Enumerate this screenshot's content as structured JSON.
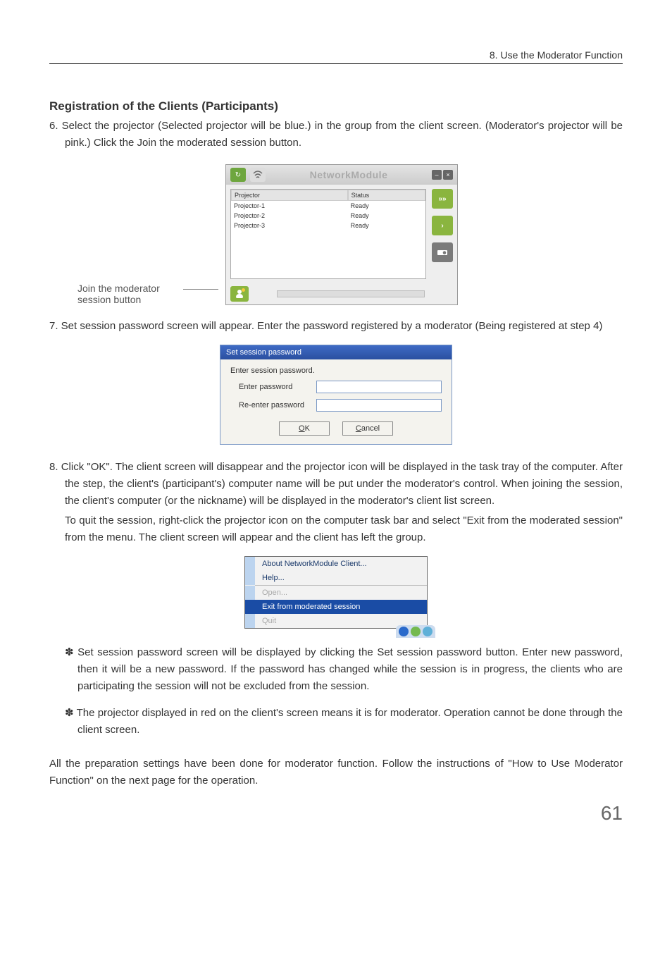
{
  "header": {
    "chapter": "8. Use the Moderator Function"
  },
  "title": "Registration of the Clients (Participants)",
  "step6": "6. Select the projector (Selected projector will be blue.) in the group from the client screen. (Moderator's projector will be pink.) Click the Join the moderated session button.",
  "callout": "Join the moderator session button",
  "nm": {
    "title": "NetworkModule",
    "col_projector": "Projector",
    "col_status": "Status",
    "rows": [
      {
        "name": "Projector-1",
        "status": "Ready"
      },
      {
        "name": "Projector-2",
        "status": "Ready"
      },
      {
        "name": "Projector-3",
        "status": "Ready"
      }
    ]
  },
  "step7": "7. Set session password screen will appear. Enter the password registered by a moderator (Being registered at step 4)",
  "pw": {
    "title": "Set session password",
    "prompt": "Enter session password.",
    "label1": "Enter password",
    "label2": "Re-enter password",
    "ok": "OK",
    "cancel": "Cancel"
  },
  "step8a": "8. Click \"OK\". The client screen will disappear and the projector icon will be displayed in the task tray of the computer. After the step, the client's (participant's) computer name will be put under the moderator's control. When joining the session, the client's computer (or the nickname) will be displayed in the moderator's client list screen.",
  "step8b": "To quit the session, right-click the projector icon on the computer task bar and select \"Exit from the moderated session\" from the menu. The client screen will appear and the client has left the group.",
  "ctx": {
    "about": "About NetworkModule Client...",
    "help": "Help...",
    "open": "Open...",
    "exit": "Exit from moderated session",
    "quit": "Quit"
  },
  "note1": "✽ Set session password screen will be displayed by clicking the Set session password button. Enter new password, then it will be a new password. If the password has changed while the session is in progress, the clients who are participating the session will not be excluded from the session.",
  "note2": "✽ The projector displayed in red on the client's screen means it is for moderator. Operation cannot be done through the client screen.",
  "footer": "All the preparation settings have been done for moderator function. Follow the instructions of \"How to Use Moderator Function\" on the next page for the operation.",
  "page": "61"
}
